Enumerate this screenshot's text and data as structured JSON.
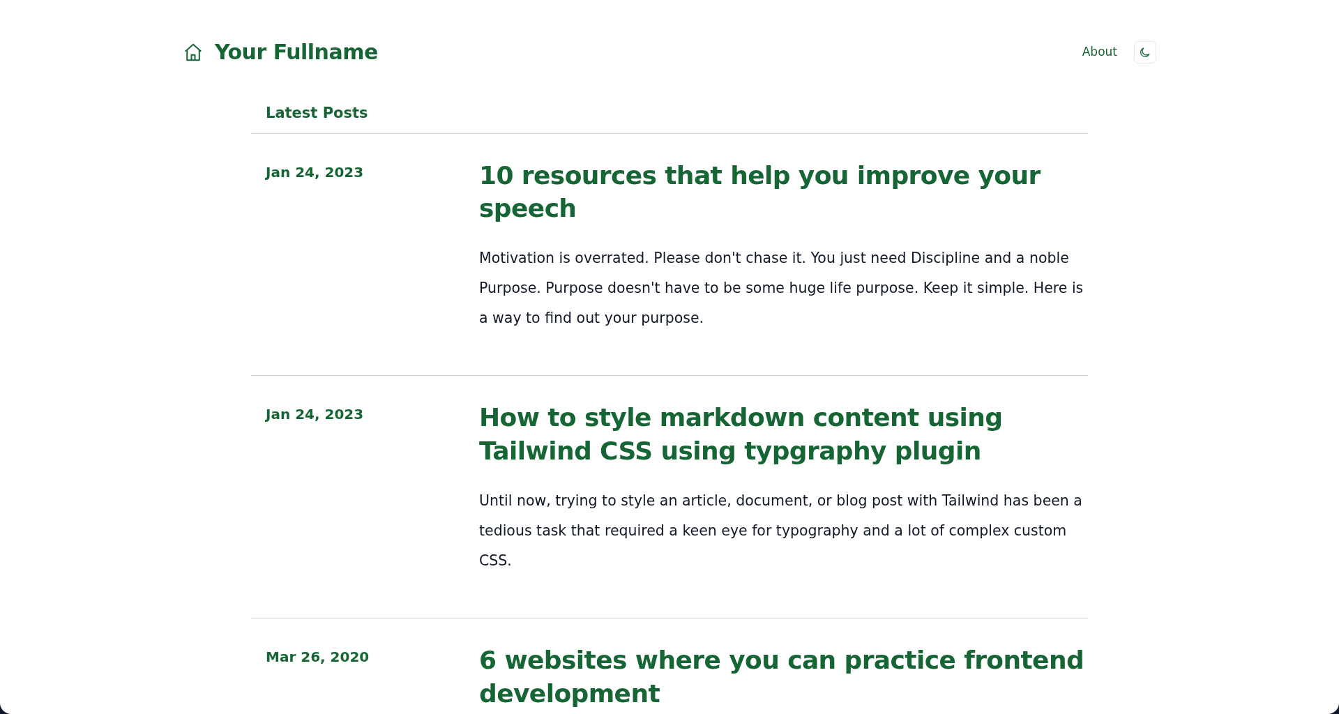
{
  "header": {
    "site_name": "Your Fullname",
    "nav_links": [
      "About"
    ]
  },
  "section_title": "Latest Posts",
  "posts": [
    {
      "date": "Jan 24, 2023",
      "title": "10 resources that help you improve your speech",
      "excerpt": "Motivation is overrated. Please don't chase it. You just need Discipline and a noble Purpose. Purpose doesn't have to be some huge life purpose. Keep it simple. Here is a way to find out your purpose."
    },
    {
      "date": "Jan 24, 2023",
      "title": "How to style markdown content using Tailwind CSS using typgraphy plugin",
      "excerpt": "Until now, trying to style an article, document, or blog post with Tailwind has been a tedious task that required a keen eye for typography and a lot of complex custom CSS."
    },
    {
      "date": "Mar 26, 2020",
      "title": "6 websites where you can practice frontend development"
    }
  ]
}
